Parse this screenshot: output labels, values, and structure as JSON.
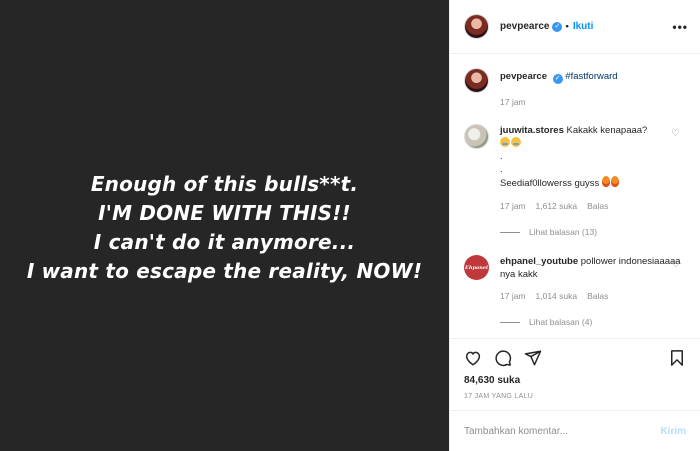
{
  "media": {
    "lines": [
      "Enough of this bulls**t.",
      "I'M DONE WITH THIS!!",
      "I can't do it anymore...",
      "I want to escape the reality, NOW!"
    ]
  },
  "header": {
    "username": "pevpearce",
    "separator": "•",
    "follow_label": "Ikuti",
    "more_label": "•••"
  },
  "caption": {
    "username": "pevpearce",
    "hashtag": "#fastforward",
    "time": "17 jam"
  },
  "comments": [
    {
      "username": "juuwita.stores",
      "text_line1": "Kakakk kenapaaa?",
      "dot1": ".",
      "dot2": ".",
      "text_line3": "Seediaf0llowerss guyss",
      "time": "17 jam",
      "likes": "1,612 suka",
      "reply_label": "Balas",
      "replies_label": "Lihat balasan (13)",
      "avatar_label": ""
    },
    {
      "username": "ehpanel_youtube",
      "text": "pollower indonesiaaaaa nya kakk",
      "time": "17 jam",
      "likes": "1,014 suka",
      "reply_label": "Balas",
      "replies_label": "Lihat balasan (4)",
      "avatar_label": "Ehpanel"
    }
  ],
  "actions": {
    "icons": [
      "heart-icon",
      "comment-icon",
      "share-icon",
      "bookmark-icon"
    ],
    "likes": "84,630 suka",
    "time_ago": "17 JAM YANG LALU"
  },
  "comment_box": {
    "placeholder": "Tambahkan komentar...",
    "submit_label": "Kirim"
  },
  "colors": {
    "media_bg": "#262626",
    "link_blue": "#0095f6",
    "hashtag": "#00376b",
    "verified": "#3897f0",
    "muted": "#8e8e8e"
  }
}
